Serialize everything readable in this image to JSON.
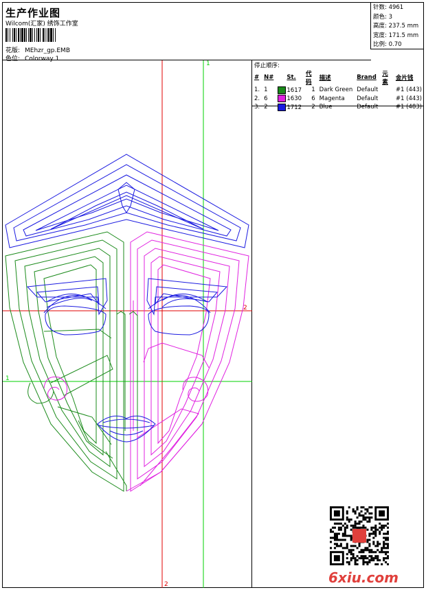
{
  "header": {
    "title": "生产作业图",
    "company": "Wilcom(汇家) 绣饰工作室",
    "design_label": "花版:",
    "design_value": "MEhzr_gp.EMB",
    "colorway_label": "色位:",
    "colorway_value": "Colorway 1"
  },
  "specs": {
    "stitches_label": "针数:",
    "stitches_value": "4961",
    "colors_label": "颜色:",
    "colors_value": "3",
    "height_label": "高度:",
    "height_value": "237.5 mm",
    "width_label": "宽度:",
    "width_value": "171.5 mm",
    "scale_label": "比例:",
    "scale_value": "0.70"
  },
  "stop_sequence": {
    "title": "停止顺序:",
    "headers": [
      "#",
      "N#",
      "St.",
      "代码",
      "描述",
      "Brand",
      "元素",
      "金片钱"
    ],
    "rows": [
      {
        "num": "1.",
        "n": "1",
        "color": "#1a8a1a",
        "st": "1617",
        "code": "1",
        "desc": "Dark Green",
        "brand": "Default",
        "elem": "#1 (443)"
      },
      {
        "num": "2.",
        "n": "6",
        "color": "#e020e0",
        "st": "1630",
        "code": "6",
        "desc": "Magenta",
        "brand": "Default",
        "elem": "#1 (443)"
      },
      {
        "num": "3.",
        "n": "2",
        "color": "#1a1ae0",
        "st": "1712",
        "code": "2",
        "desc": "Blue",
        "brand": "Default",
        "elem": "#1 (483)"
      }
    ]
  },
  "guides": {
    "v_red_label": "2",
    "v_green_label": "1",
    "h_red_label": "2",
    "h_green_label": "1"
  },
  "colors": {
    "green": "#1a8a1a",
    "magenta": "#e020e0",
    "blue": "#1a1ae0",
    "red_guide": "#e00000",
    "green_guide": "#00d000"
  },
  "footer": {
    "brand": "6xiu.com"
  }
}
